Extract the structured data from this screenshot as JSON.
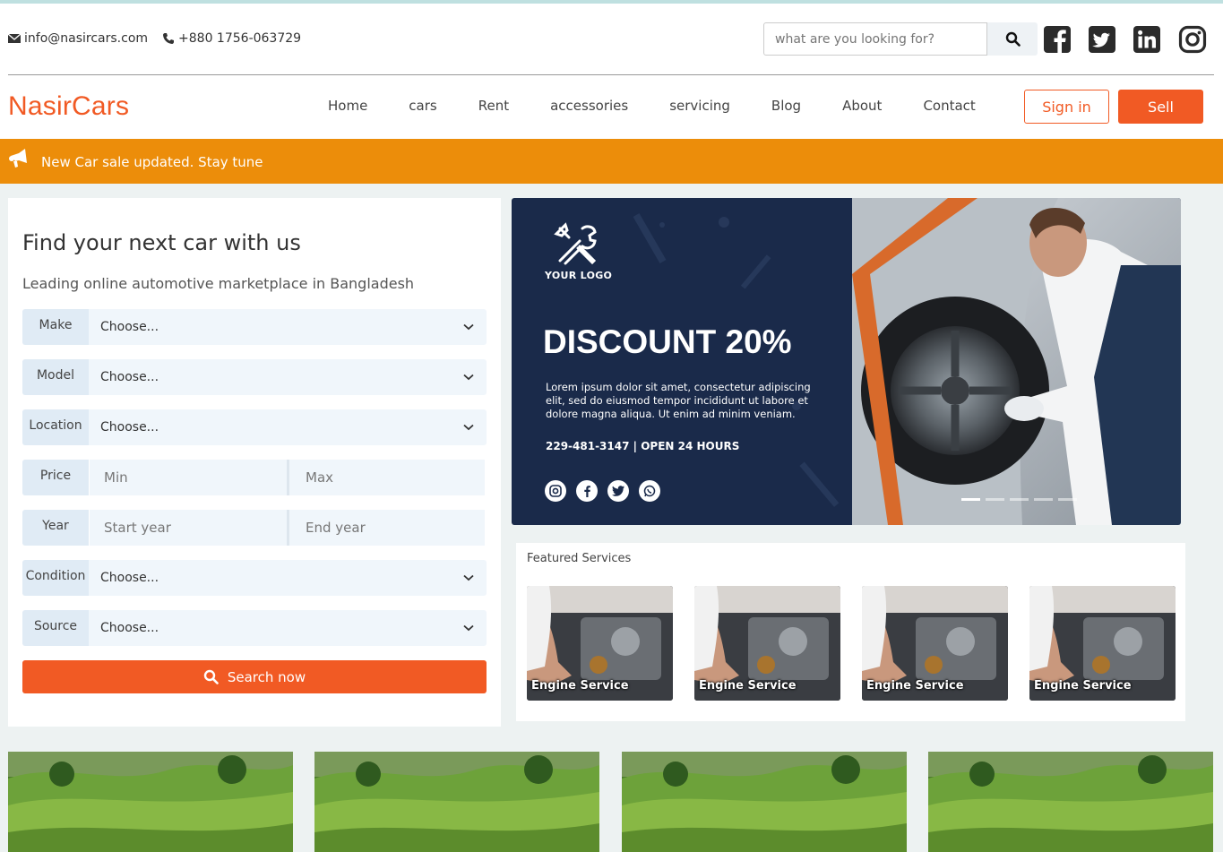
{
  "topbar": {
    "email": "info@nasircars.com",
    "phone": "+880 1756-063729",
    "search_placeholder": "what are you looking for?",
    "social_icons": [
      "facebook-icon",
      "twitter-icon",
      "linkedin-icon",
      "instagram-icon"
    ]
  },
  "nav": {
    "brand": "NasirCars",
    "links": [
      "Home",
      "cars",
      "Rent",
      "accessories",
      "servicing",
      "Blog",
      "About",
      "Contact"
    ],
    "signin": "Sign in",
    "sell": "Sell"
  },
  "announcement": "New Car sale updated. Stay tune",
  "finder": {
    "title": "Find your next car with us",
    "subtitle": "Leading online automotive marketplace in Bangladesh",
    "fields": [
      {
        "label": "Make",
        "value": "Choose..."
      },
      {
        "label": "Model",
        "value": "Choose..."
      },
      {
        "label": "Location",
        "value": "Choose..."
      },
      {
        "label": "Price",
        "min": "Min",
        "max": "Max"
      },
      {
        "label": "Year",
        "min": "Start year",
        "max": "End year"
      },
      {
        "label": "Condition",
        "value": "Choose..."
      },
      {
        "label": "Source",
        "value": "Choose..."
      }
    ],
    "search_button": "Search now"
  },
  "banner": {
    "logo_text": "YOUR LOGO",
    "headline": "DISCOUNT 20%",
    "body": "Lorem ipsum dolor sit amet, consectetur adipiscing elit, sed do eiusmod tempor incididunt ut labore et dolore magna aliqua. Ut enim ad minim veniam.",
    "contact": "229-481-3147 | OPEN 24 HOURS",
    "slide_count": 5,
    "active_slide": 1
  },
  "featured": {
    "title": "Featured Services",
    "services": [
      "Engine Service",
      "Engine Service",
      "Engine Service",
      "Engine Service"
    ]
  },
  "colors": {
    "accent": "#f15a24",
    "announce": "#ec8d0a",
    "banner_bg": "#1a2a4a"
  }
}
